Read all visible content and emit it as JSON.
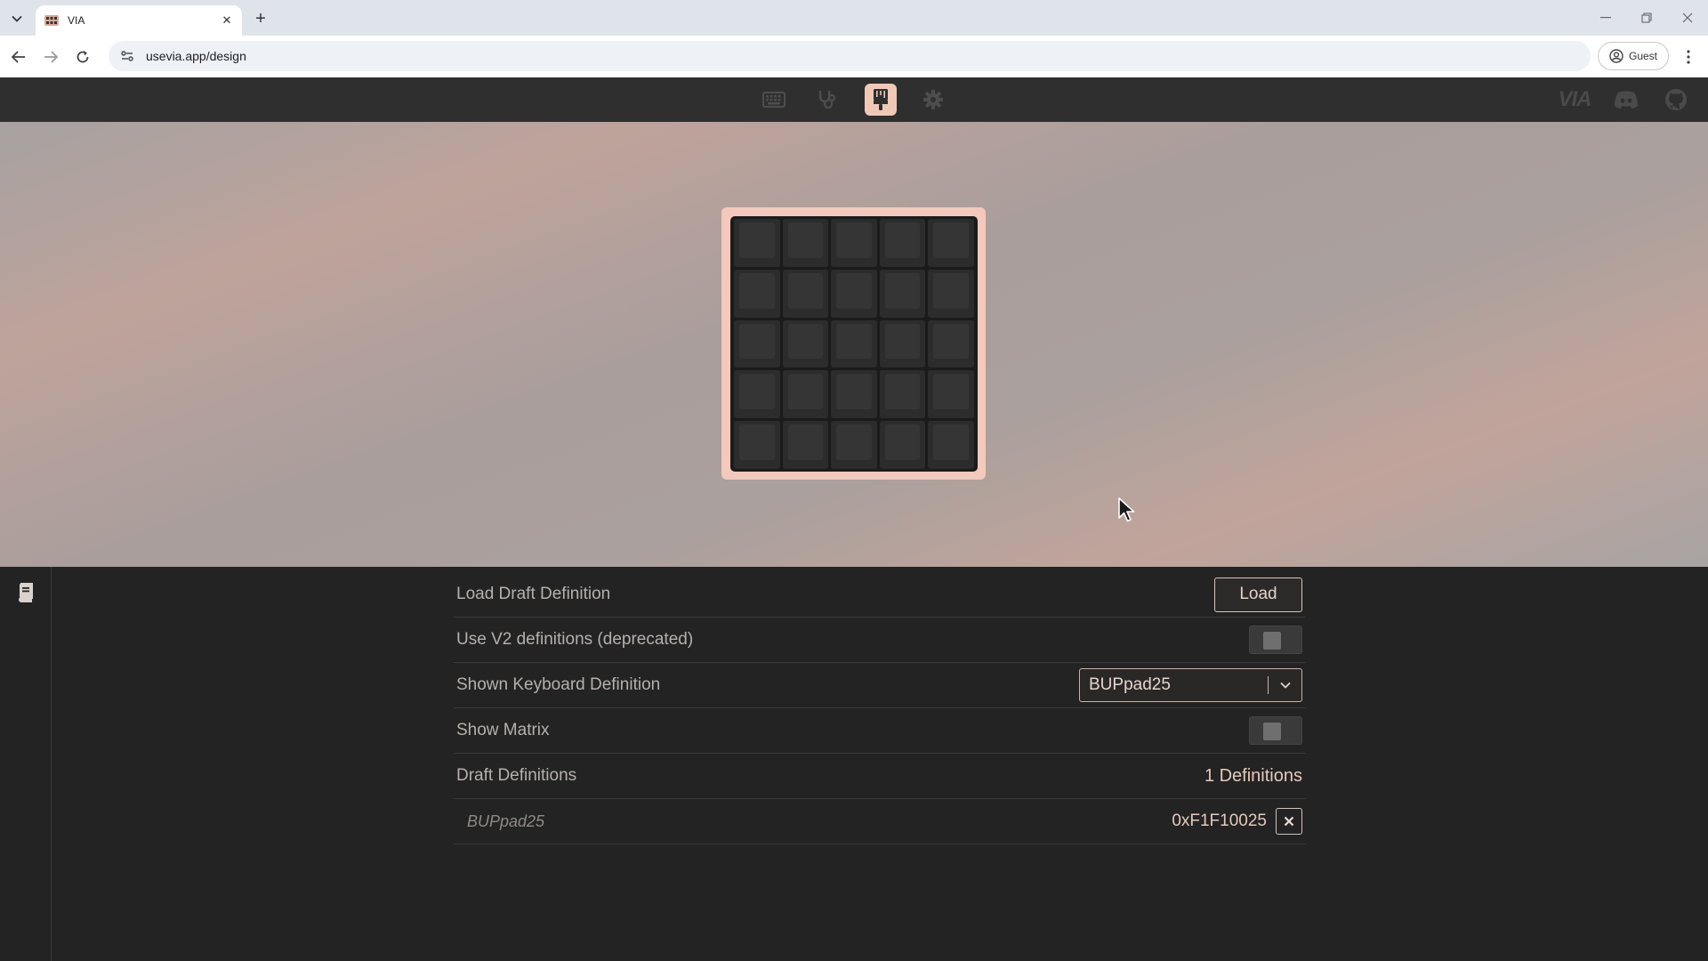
{
  "browser": {
    "tab_title": "VIA",
    "url": "usevia.app/design",
    "profile_label": "Guest"
  },
  "app": {
    "logo_text": "VIA",
    "nav": [
      "keyboard-icon",
      "stethoscope-icon",
      "paintbrush-icon",
      "gear-icon"
    ],
    "active_nav": "paintbrush-icon",
    "accent_color": "#f0c8b8"
  },
  "keyboard": {
    "rows": 5,
    "cols": 5
  },
  "settings": {
    "load_draft": {
      "label": "Load Draft Definition",
      "button": "Load"
    },
    "use_v2": {
      "label": "Use V2 definitions (deprecated)",
      "enabled": false
    },
    "shown_definition": {
      "label": "Shown Keyboard Definition",
      "value": "BUPpad25"
    },
    "show_matrix": {
      "label": "Show Matrix",
      "enabled": false
    },
    "draft_definitions": {
      "label": "Draft Definitions",
      "count": "1 Definitions"
    },
    "definitions": [
      {
        "name": "BUPpad25",
        "id": "0xF1F10025"
      }
    ]
  }
}
